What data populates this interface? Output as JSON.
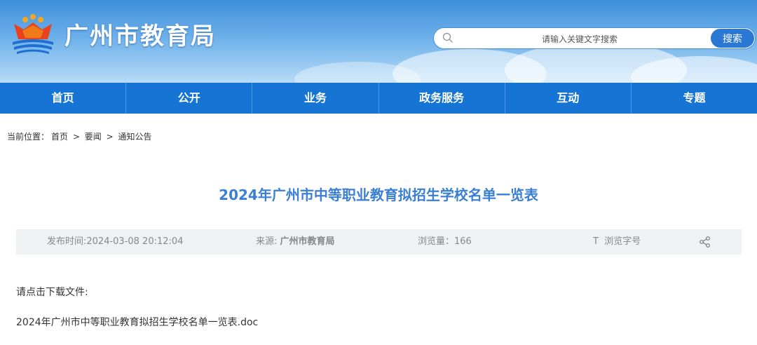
{
  "header": {
    "site_title": "广州市教育局",
    "search_placeholder": "请输入关键文字搜索",
    "search_button": "搜索"
  },
  "nav": {
    "items": [
      "首页",
      "公开",
      "业务",
      "政务服务",
      "互动",
      "专题"
    ]
  },
  "breadcrumb": {
    "prefix": "当前位置：",
    "items": [
      "首页",
      "要闻",
      "通知公告"
    ],
    "separator": ">"
  },
  "article": {
    "title": "2024年广州市中等职业教育拟招生学校名单一览表",
    "publish_time": "发布时间:2024-03-08 20:12:04",
    "source_label": "来源: ",
    "source_value": "广州市教育局",
    "views": "浏览量：166",
    "font_size_label": "T  浏览字号",
    "download_prompt": "请点击下载文件:",
    "attachment": "2024年广州市中等职业教育拟招生学校名单一览表.doc"
  },
  "icons": {
    "search": "search-icon",
    "share": "share-icon",
    "logo": "emblem-logo"
  },
  "colors": {
    "nav_bg": "#1574d4",
    "title": "#3a7fd5",
    "search_button": "#2b78d4"
  }
}
